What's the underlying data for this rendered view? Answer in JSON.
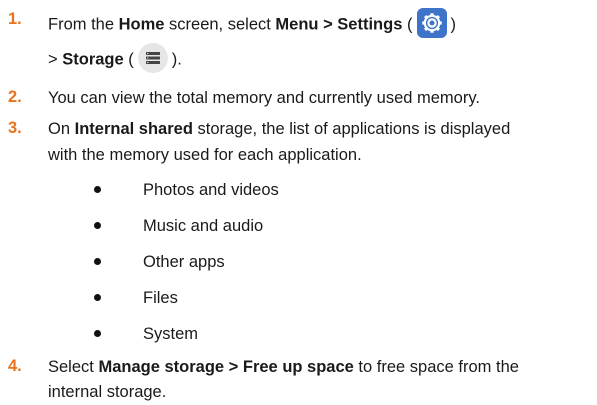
{
  "steps": [
    {
      "number": "1.",
      "line1": {
        "t1": "From the ",
        "b1": "Home",
        "t2": " screen, select ",
        "b2": "Menu > Settings",
        "t3": " (",
        "t4": ")"
      },
      "line2": {
        "t1": "> ",
        "b1": "Storage",
        "t2": " (",
        "t3": ")."
      }
    },
    {
      "number": "2.",
      "text": "You can view the total memory and currently used memory."
    },
    {
      "number": "3.",
      "line1": {
        "t1": "On ",
        "b1": "Internal shared",
        "t2": " storage, the list of applications is displayed"
      },
      "line2": "with the memory used for each application.",
      "bullets": [
        "Photos and videos",
        "Music and audio",
        "Other apps",
        "Files",
        "System"
      ]
    },
    {
      "number": "4.",
      "line1": {
        "t1": "Select ",
        "b1": "Manage storage > Free up space",
        "t2": " to free space from the"
      },
      "line2": "internal storage."
    }
  ],
  "icons": {
    "settings": "gear-icon",
    "storage": "storage-icon"
  },
  "colors": {
    "step_number": "#e8731e",
    "settings_icon_bg": "#3d73c9",
    "storage_icon_bg": "#e6e6e6"
  }
}
